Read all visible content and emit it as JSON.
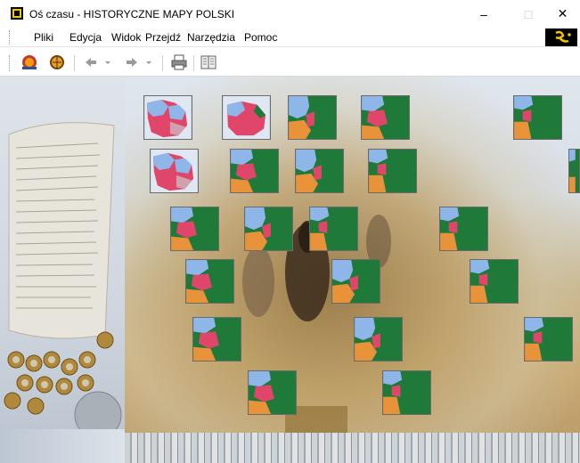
{
  "window": {
    "title": "Oś czasu - HISTORYCZNE MAPY POLSKI",
    "min_label": "–",
    "max_label": "□",
    "close_label": "✕"
  },
  "menu": {
    "items": [
      "Pliki",
      "Edycja",
      "Widok",
      "Przejdź",
      "Narzędzia",
      "Pomoc"
    ]
  },
  "toolbar": {
    "icons": [
      "globe-icon",
      "gold-globe-icon",
      "back-arrow-icon",
      "dropdown-arrow-icon",
      "forward-arrow-icon",
      "dropdown-arrow-icon",
      "print-icon",
      "book-icon"
    ]
  },
  "map_tiles": {
    "variants": [
      "pink-blue",
      "pink-blue",
      "green-large",
      "green-small",
      "green-large"
    ]
  },
  "colors": {
    "map_green": "#1f7a3a",
    "map_pink": "#e0456a",
    "map_blue": "#8fb6e8",
    "map_orange": "#e8923a"
  }
}
